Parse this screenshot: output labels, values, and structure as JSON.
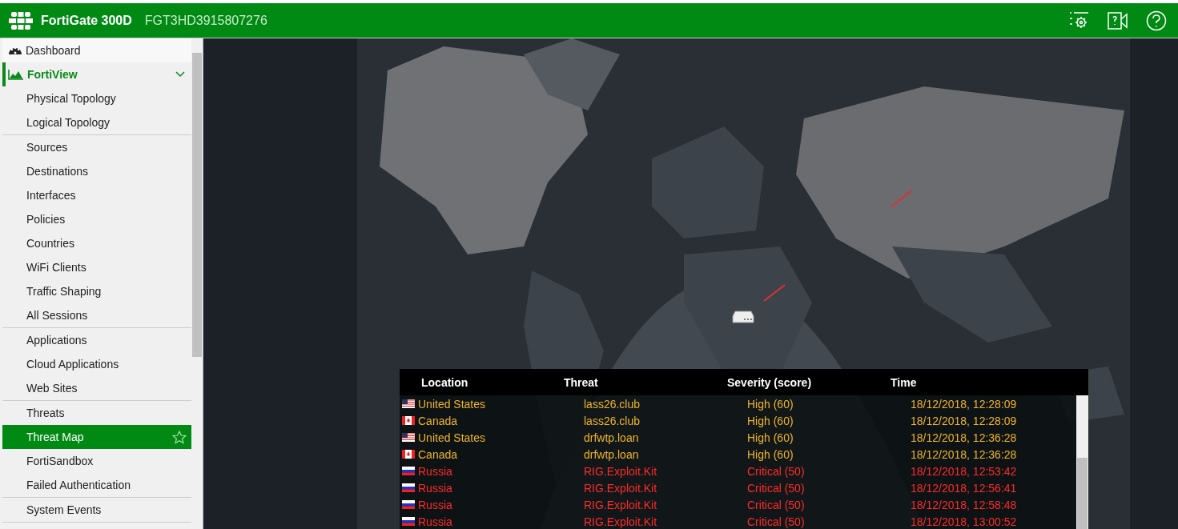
{
  "header": {
    "product": "FortiGate 300D",
    "serial": "FGT3HD3915807276"
  },
  "sidebar": {
    "items": [
      {
        "label": "Dashboard",
        "expanded": false
      },
      {
        "label": "FortiView",
        "expanded": true,
        "children": [
          {
            "items": [
              {
                "label": "Physical Topology",
                "selected": false
              },
              {
                "label": "Logical Topology",
                "selected": false
              }
            ]
          },
          {
            "items": [
              {
                "label": "Sources",
                "selected": false
              },
              {
                "label": "Destinations",
                "selected": false
              },
              {
                "label": "Interfaces",
                "selected": false
              },
              {
                "label": "Policies",
                "selected": false
              },
              {
                "label": "Countries",
                "selected": false
              },
              {
                "label": "WiFi Clients",
                "selected": false
              },
              {
                "label": "Traffic Shaping",
                "selected": false
              },
              {
                "label": "All Sessions",
                "selected": false
              }
            ]
          },
          {
            "items": [
              {
                "label": "Applications",
                "selected": false
              },
              {
                "label": "Cloud Applications",
                "selected": false
              },
              {
                "label": "Web Sites",
                "selected": false
              }
            ]
          },
          {
            "items": [
              {
                "label": "Threats",
                "selected": false
              },
              {
                "label": "Threat Map",
                "selected": true
              },
              {
                "label": "FortiSandbox",
                "selected": false
              },
              {
                "label": "Failed Authentication",
                "selected": false
              }
            ]
          },
          {
            "items": [
              {
                "label": "System Events",
                "selected": false
              }
            ]
          }
        ]
      }
    ]
  },
  "threat_table": {
    "columns": [
      "Location",
      "Threat",
      "Severity (score)",
      "Time"
    ],
    "rows": [
      {
        "kind": "us",
        "location": "United States",
        "threat": "lass26.club",
        "severity": "High (60)",
        "time": "18/12/2018, 12:28:09",
        "color": "#f0b429"
      },
      {
        "kind": "ca",
        "location": "Canada",
        "threat": "lass26.club",
        "severity": "High (60)",
        "time": "18/12/2018, 12:28:09",
        "color": "#f0b429"
      },
      {
        "kind": "us",
        "location": "United States",
        "threat": "drfwtp.loan",
        "severity": "High (60)",
        "time": "18/12/2018, 12:36:28",
        "color": "#f0b429"
      },
      {
        "kind": "ca",
        "location": "Canada",
        "threat": "drfwtp.loan",
        "severity": "High (60)",
        "time": "18/12/2018, 12:36:28",
        "color": "#f0b429"
      },
      {
        "kind": "ru",
        "location": "Russia",
        "threat": "RIG.Exploit.Kit",
        "severity": "Critical (50)",
        "time": "18/12/2018, 12:53:42",
        "color": "#ff2a2a"
      },
      {
        "kind": "ru",
        "location": "Russia",
        "threat": "RIG.Exploit.Kit",
        "severity": "Critical (50)",
        "time": "18/12/2018, 12:56:41",
        "color": "#ff2a2a"
      },
      {
        "kind": "ru",
        "location": "Russia",
        "threat": "RIG.Exploit.Kit",
        "severity": "Critical (50)",
        "time": "18/12/2018, 12:58:48",
        "color": "#ff2a2a"
      },
      {
        "kind": "ru",
        "location": "Russia",
        "threat": "RIG.Exploit.Kit",
        "severity": "Critical (50)",
        "time": "18/12/2018, 13:00:52",
        "color": "#ff2a2a"
      }
    ]
  }
}
